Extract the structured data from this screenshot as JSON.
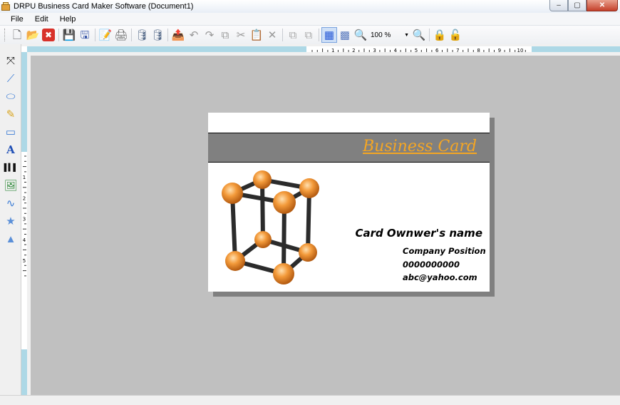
{
  "window": {
    "title": "DRPU Business Card Maker Software  (Document1)",
    "controls": {
      "minimize": "–",
      "maximize": "▢",
      "close": "✕"
    }
  },
  "menu": {
    "items": [
      "File",
      "Edit",
      "Help"
    ]
  },
  "toolbar": {
    "zoom_value": "100 %",
    "zoom_arrow": "▼",
    "buttons": [
      {
        "icon": "new-document-icon",
        "glyph": "🗋"
      },
      {
        "icon": "open-folder-icon",
        "glyph": "📂"
      },
      {
        "icon": "close-document-icon",
        "glyph": "✖"
      },
      {
        "icon": "save-icon",
        "glyph": "💾"
      },
      {
        "icon": "save-as-icon",
        "glyph": "🖫"
      },
      {
        "icon": "edit-icon",
        "glyph": "📝"
      },
      {
        "icon": "print-icon",
        "glyph": "🖨"
      },
      {
        "icon": "database-import-icon",
        "glyph": "🛢"
      },
      {
        "icon": "database-icon",
        "glyph": "🛢"
      },
      {
        "icon": "export-icon",
        "glyph": "📤"
      },
      {
        "icon": "undo-icon",
        "glyph": "↶"
      },
      {
        "icon": "redo-icon",
        "glyph": "↷"
      },
      {
        "icon": "copy-icon",
        "glyph": "⧉"
      },
      {
        "icon": "cut-icon",
        "glyph": "✂"
      },
      {
        "icon": "paste-icon",
        "glyph": "📋"
      },
      {
        "icon": "delete-icon",
        "glyph": "✕"
      },
      {
        "icon": "bring-front-icon",
        "glyph": "⧉"
      },
      {
        "icon": "send-back-icon",
        "glyph": "⧉"
      },
      {
        "icon": "grid-icon",
        "glyph": "▦"
      },
      {
        "icon": "grid-toggle-icon",
        "glyph": "▩"
      },
      {
        "icon": "zoom-in-icon",
        "glyph": "🔍"
      },
      {
        "icon": "zoom-out-icon",
        "glyph": "🔍"
      },
      {
        "icon": "lock-icon",
        "glyph": "🔒"
      },
      {
        "icon": "unlock-icon",
        "glyph": "🔓"
      }
    ]
  },
  "ruler": {
    "labels": [
      "1",
      "2",
      "3",
      "4",
      "5",
      "6",
      "7",
      "8",
      "9",
      "10"
    ],
    "left_labels": [
      "1",
      "2",
      "3",
      "4",
      "5"
    ]
  },
  "tools": [
    {
      "icon": "select-pointer-icon",
      "glyph": "⤧"
    },
    {
      "icon": "line-tool-icon",
      "glyph": "⟋"
    },
    {
      "icon": "ellipse-tool-icon",
      "glyph": "⬭"
    },
    {
      "icon": "pencil-tool-icon",
      "glyph": "✎"
    },
    {
      "icon": "rectangle-tool-icon",
      "glyph": "▭"
    },
    {
      "icon": "text-tool-icon",
      "glyph": "A"
    },
    {
      "icon": "barcode-tool-icon",
      "glyph": "▌▍▌"
    },
    {
      "icon": "image-tool-icon",
      "glyph": "🖼"
    },
    {
      "icon": "curve-tool-icon",
      "glyph": "∿"
    },
    {
      "icon": "star-tool-icon",
      "glyph": "★"
    },
    {
      "icon": "triangle-tool-icon",
      "glyph": "▲"
    }
  ],
  "card": {
    "title": "Business Card",
    "owner_name": "Card Ownwer's name",
    "position": "Company Position",
    "phone": "0000000000",
    "email": "abc@yahoo.com"
  },
  "colors": {
    "accent": "#f5a623",
    "band": "#808080",
    "canvas": "#c0c0c0",
    "ruler": "#add8e6"
  }
}
